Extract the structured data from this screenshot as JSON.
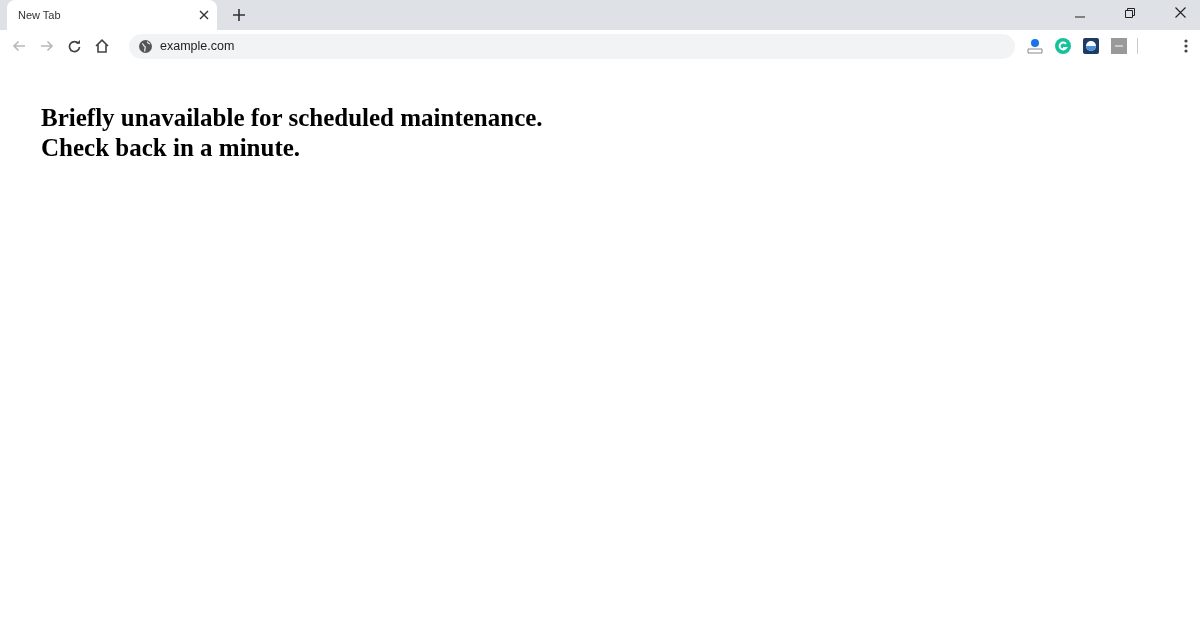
{
  "tabs": [
    {
      "label": "New Tab",
      "selected": true
    }
  ],
  "toolbar": {
    "back": {
      "disabled": true
    },
    "forward": {
      "disabled": true
    },
    "address": "example.com"
  },
  "page": {
    "lines": [
      "Briefly unavailable for scheduled maintenance.",
      "Check back in a minute."
    ]
  }
}
